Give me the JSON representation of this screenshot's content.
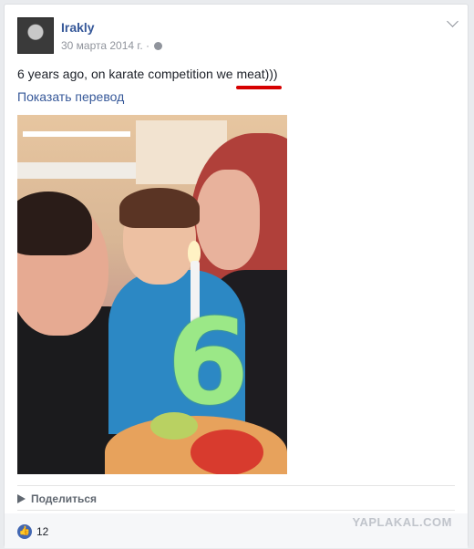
{
  "post": {
    "author": "Irakly",
    "date": "30 марта 2014 г. ·",
    "text": "6 years ago, on karate competition we meat)))",
    "translate_link": "Показать перевод",
    "photo_overlay_text": "6",
    "share_label": "Поделиться",
    "likes_count": "12"
  },
  "watermark": "YAPLAKAL.COM",
  "colors": {
    "link": "#365899",
    "muted": "#90949c",
    "highlight": "#d60000",
    "like": "#4267b2"
  },
  "icons": [
    "globe-icon",
    "chevron-down-icon",
    "share-icon",
    "like-icon"
  ]
}
